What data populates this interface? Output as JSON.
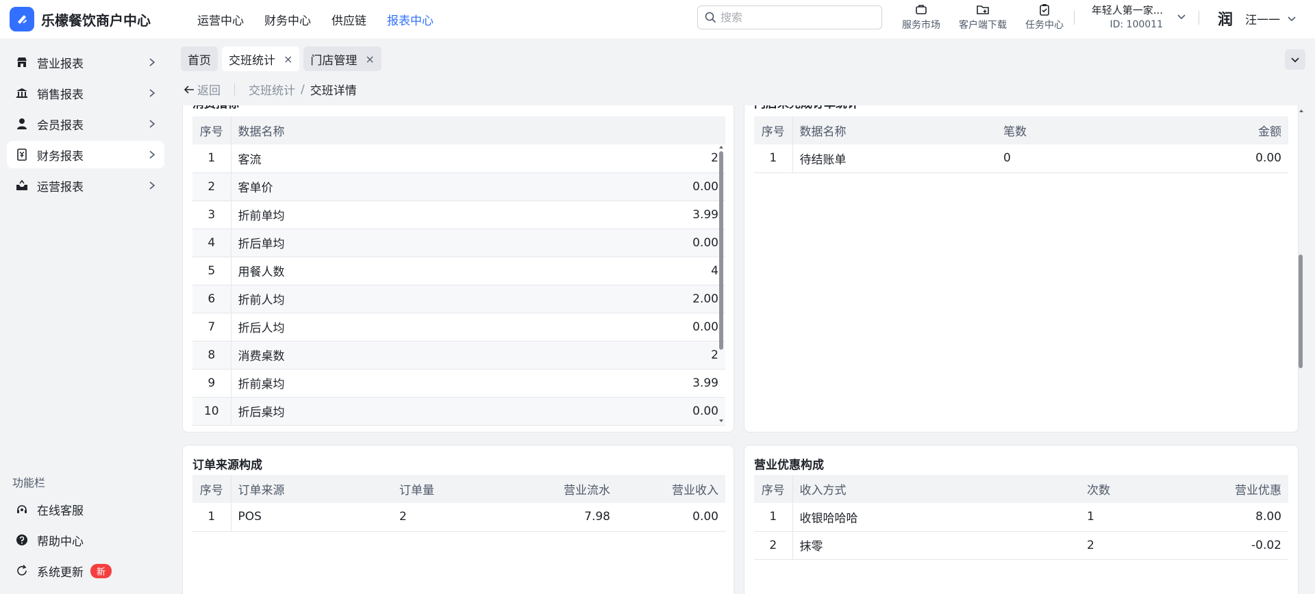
{
  "app": {
    "name": "乐檬餐饮商户中心"
  },
  "topnav": [
    "运营中心",
    "财务中心",
    "供应链",
    "报表中心"
  ],
  "search": {
    "placeholder": "搜索"
  },
  "tools": [
    "服务市场",
    "客户端下载",
    "任务中心"
  ],
  "store": {
    "name": "年轻人第一家...",
    "id": "ID: 100011"
  },
  "user": {
    "avatar": "润",
    "name": "汪一一"
  },
  "sidebar": {
    "items": [
      "营业报表",
      "销售报表",
      "会员报表",
      "财务报表",
      "运营报表"
    ],
    "active": "财务报表",
    "func_title": "功能栏",
    "func": [
      "在线客服",
      "帮助中心",
      "系统更新"
    ],
    "badge": "新"
  },
  "tabs": [
    {
      "label": "首页"
    },
    {
      "label": "交班统计",
      "closable": "×"
    },
    {
      "label": "门店管理",
      "closable": "×"
    }
  ],
  "breadcrumb": {
    "back": "返回",
    "path1": "交班统计",
    "path2": "交班详情",
    "slash": "/"
  },
  "consume": {
    "title": "消费指标",
    "headers": [
      "序号",
      "数据名称",
      ""
    ],
    "rows": [
      [
        "1",
        "客流",
        "2"
      ],
      [
        "2",
        "客单价",
        "0.00"
      ],
      [
        "3",
        "折前单均",
        "3.99"
      ],
      [
        "4",
        "折后单均",
        "0.00"
      ],
      [
        "5",
        "用餐人数",
        "4"
      ],
      [
        "6",
        "折前人均",
        "2.00"
      ],
      [
        "7",
        "折后人均",
        "0.00"
      ],
      [
        "8",
        "消费桌数",
        "2"
      ],
      [
        "9",
        "折前桌均",
        "3.99"
      ],
      [
        "10",
        "折后桌均",
        "0.00"
      ]
    ]
  },
  "unfinished": {
    "title": "门店未完成订单统计",
    "headers": [
      "序号",
      "数据名称",
      "笔数",
      "金额"
    ],
    "rows": [
      [
        "1",
        "待结账单",
        "0",
        "0.00"
      ]
    ]
  },
  "order_source": {
    "title": "订单来源构成",
    "headers": [
      "序号",
      "订单来源",
      "订单量",
      "营业流水",
      "营业收入"
    ],
    "rows": [
      [
        "1",
        "POS",
        "2",
        "7.98",
        "0.00"
      ]
    ]
  },
  "discount": {
    "title": "营业优惠构成",
    "headers": [
      "序号",
      "收入方式",
      "次数",
      "营业优惠"
    ],
    "rows": [
      [
        "1",
        "收银哈哈哈",
        "1",
        "8.00"
      ],
      [
        "2",
        "抹零",
        "2",
        "-0.02"
      ]
    ]
  },
  "colors": {
    "accent": "#3370ff",
    "badge": "#f53f3f"
  }
}
